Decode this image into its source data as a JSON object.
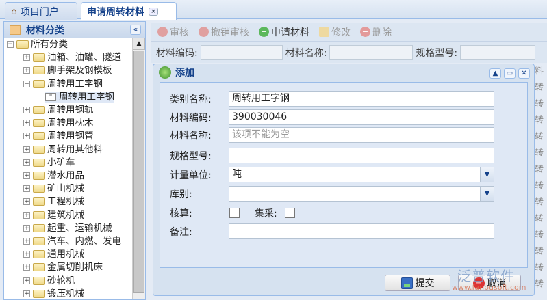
{
  "tabs": [
    {
      "label": "项目门户",
      "icon": "home-icon"
    },
    {
      "label": "申请周转材料",
      "icon": "close-icon",
      "close": "×"
    }
  ],
  "left_panel": {
    "title": "材料分类",
    "collapse": "«",
    "tree": [
      {
        "label": "所有分类",
        "level": 0,
        "toggle": "−"
      },
      {
        "label": "油箱、油罐、隧道",
        "level": 1,
        "toggle": "+"
      },
      {
        "label": "脚手架及钢模板",
        "level": 1,
        "toggle": "+"
      },
      {
        "label": "周转用工字钢",
        "level": 1,
        "toggle": "−"
      },
      {
        "label": "周转用工字钢",
        "level": 2,
        "selected": true
      },
      {
        "label": "周转用钢轨",
        "level": 1,
        "toggle": "+"
      },
      {
        "label": "周转用枕木",
        "level": 1,
        "toggle": "+"
      },
      {
        "label": "周转用钢管",
        "level": 1,
        "toggle": "+"
      },
      {
        "label": "周转用其他料",
        "level": 1,
        "toggle": "+"
      },
      {
        "label": "小矿车",
        "level": 1,
        "toggle": "+"
      },
      {
        "label": "潜水用品",
        "level": 1,
        "toggle": "+"
      },
      {
        "label": "矿山机械",
        "level": 1,
        "toggle": "+"
      },
      {
        "label": "工程机械",
        "level": 1,
        "toggle": "+"
      },
      {
        "label": "建筑机械",
        "level": 1,
        "toggle": "+"
      },
      {
        "label": "起重、运输机械",
        "level": 1,
        "toggle": "+"
      },
      {
        "label": "汽车、内燃、发电",
        "level": 1,
        "toggle": "+"
      },
      {
        "label": "通用机械",
        "level": 1,
        "toggle": "+"
      },
      {
        "label": "金属切削机床",
        "level": 1,
        "toggle": "+"
      },
      {
        "label": "砂轮机",
        "level": 1,
        "toggle": "+"
      },
      {
        "label": "锻压机械",
        "level": 1,
        "toggle": "+"
      }
    ]
  },
  "toolbar": {
    "audit": "审核",
    "unaudit": "撤销审核",
    "apply": "申请材料",
    "edit": "修改",
    "delete": "删除"
  },
  "search": {
    "code_label": "材料编码:",
    "name_label": "材料名称:",
    "spec_label": "规格型号:"
  },
  "dialog": {
    "title": "添加",
    "fields": {
      "category_label": "类别名称:",
      "category": "周转用工字钢",
      "code_label": "材料编码:",
      "code": "390030046",
      "name_label": "材料名称:",
      "name_placeholder": "该项不能为空",
      "spec_label": "规格型号:",
      "spec": "",
      "unit_label": "计量单位:",
      "unit": "吨",
      "store_label": "库别:",
      "store": "",
      "check_label": "核算:",
      "collect_label": "集采:",
      "remark_label": "备注:",
      "remark": ""
    },
    "submit": "提交",
    "cancel": "取消"
  },
  "edge_text": [
    "料",
    "转",
    "转",
    "转",
    "转",
    "转",
    "转",
    "转",
    "转",
    "转",
    "转",
    "转",
    "转",
    "转"
  ],
  "watermark": {
    "name": "泛普软件",
    "url": "www.fanpusoft.com"
  }
}
